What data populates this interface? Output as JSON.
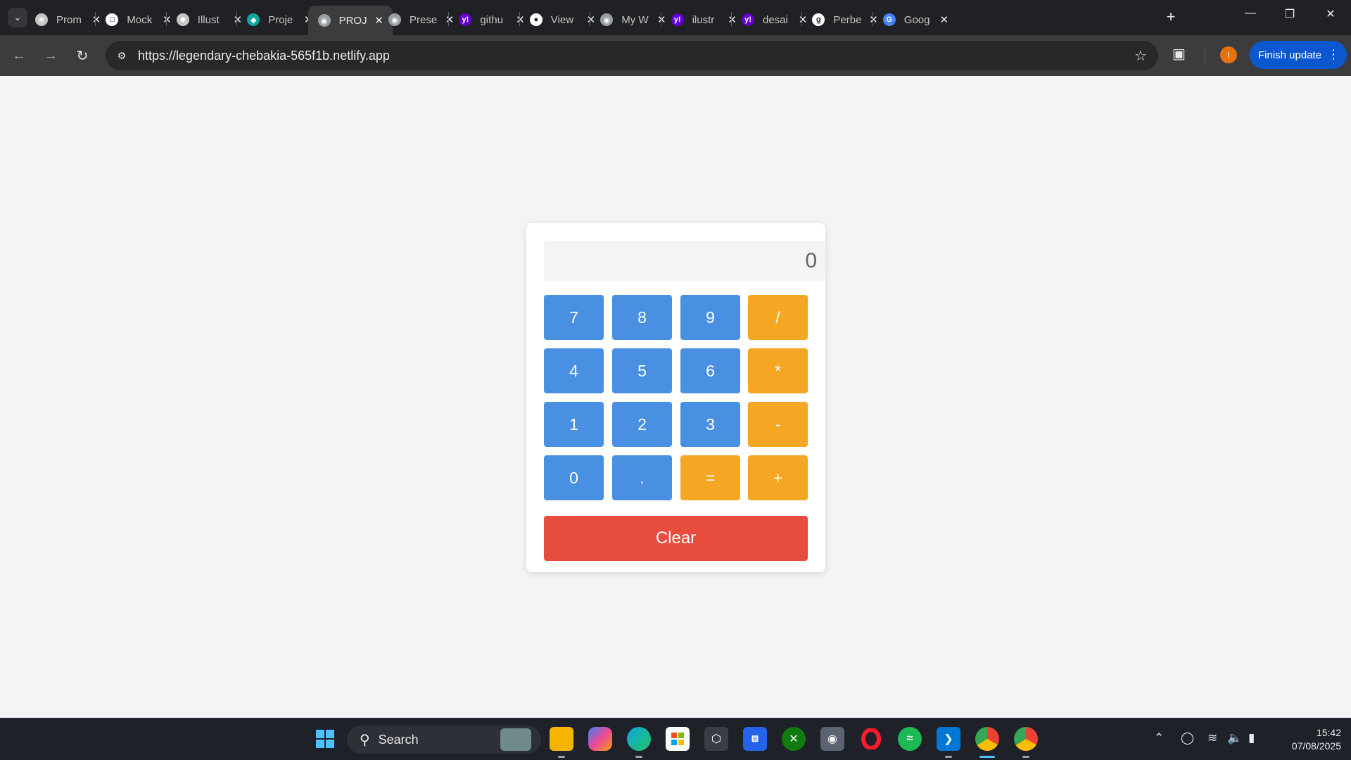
{
  "browser": {
    "tabs": [
      {
        "title": "Prom",
        "icon": "openai-icon",
        "color": "#c4c7c5"
      },
      {
        "title": "Mock",
        "icon": "mockup-icon",
        "color": "#ffffff"
      },
      {
        "title": "Illust",
        "icon": "portrait-icon",
        "color": "#c4c7c5"
      },
      {
        "title": "Proje",
        "icon": "diamond-icon",
        "color": "#12a5a0"
      },
      {
        "title": "PROJ",
        "icon": "globe-icon",
        "color": "#9aa0a6"
      },
      {
        "title": "Prese",
        "icon": "globe-icon",
        "color": "#9aa0a6"
      },
      {
        "title": "githu",
        "icon": "yahoo-icon",
        "color": "#6001d2"
      },
      {
        "title": "View",
        "icon": "github-icon",
        "color": "#ffffff"
      },
      {
        "title": "My W",
        "icon": "globe-icon",
        "color": "#9aa0a6"
      },
      {
        "title": "ilustr",
        "icon": "yahoo-icon",
        "color": "#6001d2"
      },
      {
        "title": "desai",
        "icon": "yahoo-icon",
        "color": "#6001d2"
      },
      {
        "title": "Perbe",
        "icon": "grammar-icon",
        "color": "#ffffff"
      },
      {
        "title": "Goog",
        "icon": "google-translate-icon",
        "color": "#4285f4"
      }
    ],
    "active_tab_index": 4,
    "url": "https://legendary-chebakia-565f1b.netlify.app",
    "profile_initial": "I",
    "finish_update_label": "Finish update"
  },
  "calculator": {
    "display_value": "0",
    "keys": [
      {
        "label": "7",
        "kind": "num"
      },
      {
        "label": "8",
        "kind": "num"
      },
      {
        "label": "9",
        "kind": "num"
      },
      {
        "label": "/",
        "kind": "op"
      },
      {
        "label": "4",
        "kind": "num"
      },
      {
        "label": "5",
        "kind": "num"
      },
      {
        "label": "6",
        "kind": "num"
      },
      {
        "label": "*",
        "kind": "op"
      },
      {
        "label": "1",
        "kind": "num"
      },
      {
        "label": "2",
        "kind": "num"
      },
      {
        "label": "3",
        "kind": "num"
      },
      {
        "label": "-",
        "kind": "op"
      },
      {
        "label": "0",
        "kind": "num"
      },
      {
        "label": ".",
        "kind": "num"
      },
      {
        "label": "=",
        "kind": "op"
      },
      {
        "label": "+",
        "kind": "op"
      }
    ],
    "clear_label": "Clear",
    "colors": {
      "number": "#4a90e2",
      "operator": "#f5a623",
      "clear": "#e74c3c"
    }
  },
  "taskbar": {
    "search_label": "Search",
    "apps": [
      "windows-start-icon",
      "file-explorer-icon",
      "copilot-icon",
      "edge-icon",
      "store-icon",
      "app-icon",
      "app-icon",
      "xbox-icon",
      "camera-icon",
      "opera-icon",
      "spotify-icon",
      "vscode-icon",
      "chrome-icon",
      "chrome-icon"
    ],
    "time": "15:42",
    "date": "07/08/2025"
  }
}
